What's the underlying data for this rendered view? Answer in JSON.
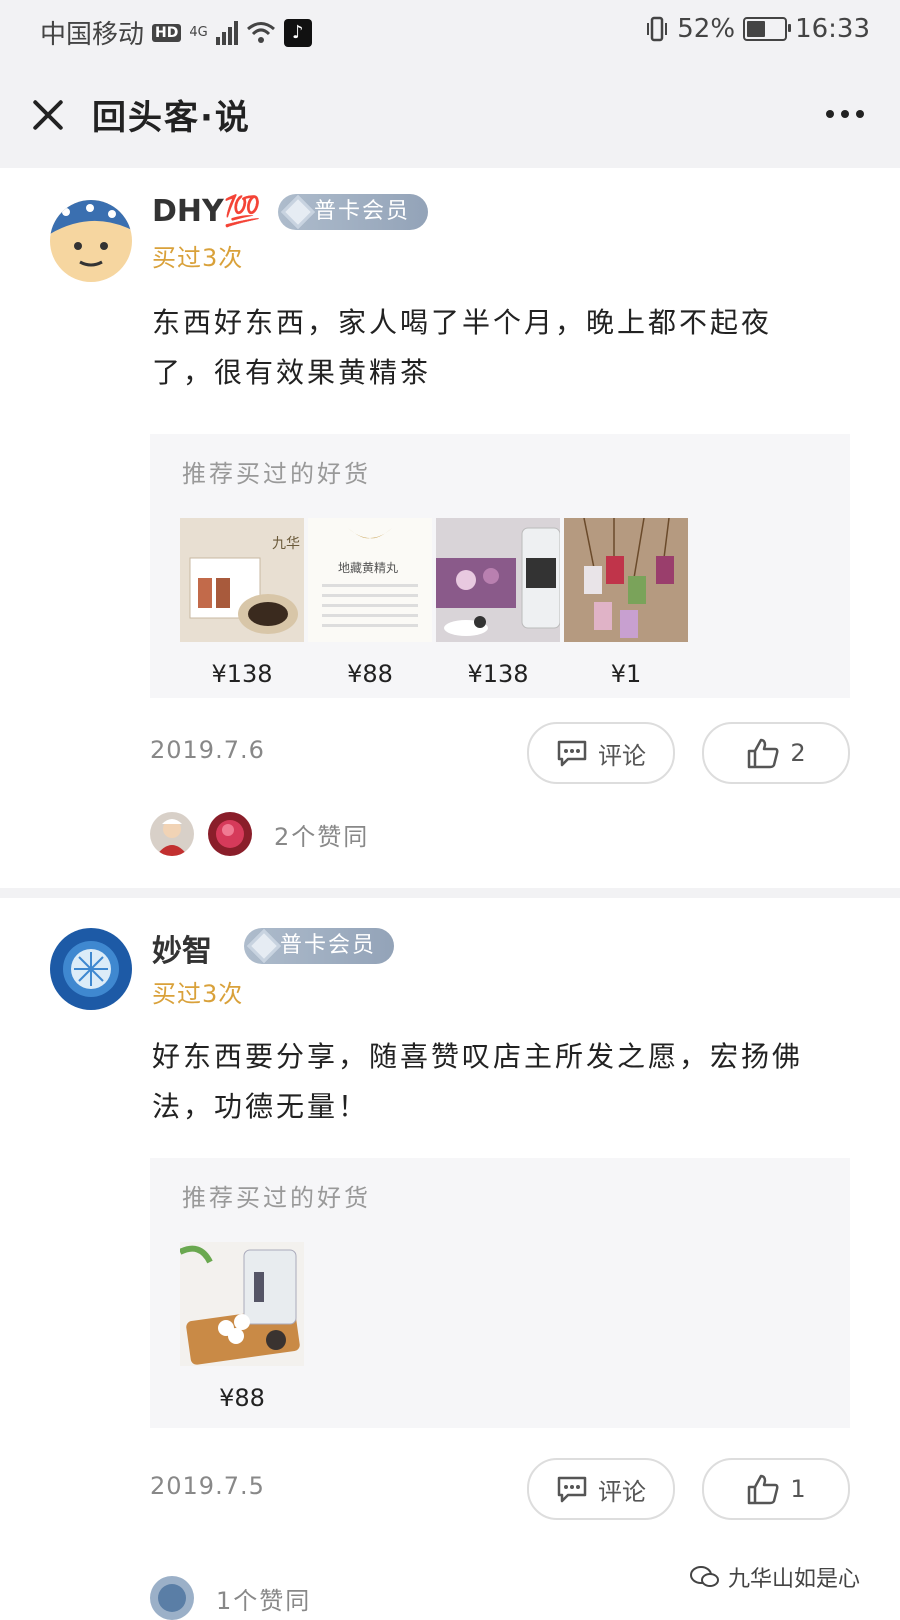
{
  "status_bar": {
    "carrier": "中国移动",
    "hd": "HD",
    "network": "4G",
    "battery_percent": "52%",
    "battery_level": 0.52,
    "time": "16:33"
  },
  "header": {
    "title": "回头客·说"
  },
  "reviews": [
    {
      "username": "DHY💯",
      "badge": "普卡会员",
      "purchase_count": "买过3次",
      "content": "东西好东西，家人喝了半个月，晚上都不起夜了，很有效果黄精茶",
      "recommend_title": "推荐买过的好货",
      "products": [
        {
          "price": "¥138",
          "image": "tea-gift-box"
        },
        {
          "price": "¥88",
          "image": "pill-package"
        },
        {
          "price": "¥138",
          "image": "tea-jar"
        },
        {
          "price": "¥1",
          "image": "sachet-pendants"
        }
      ],
      "date": "2019.7.6",
      "comment_label": "评论",
      "like_count": "2",
      "likes_text": "2个赞同"
    },
    {
      "username": "妙智",
      "badge": "普卡会员",
      "purchase_count": "买过3次",
      "content": "好东西要分享，随喜赞叹店主所发之愿，宏扬佛法，功德无量！",
      "recommend_title": "推荐买过的好货",
      "products": [
        {
          "price": "¥88",
          "image": "pill-jar"
        }
      ],
      "date": "2019.7.5",
      "comment_label": "评论",
      "like_count": "1",
      "likes_text": "1个赞同"
    }
  ],
  "watermark": "九华山如是心",
  "colors": {
    "accent_gold": "#d9a13a",
    "badge_blue": "#93a3b8",
    "bar_bg": "#f2f2f4"
  }
}
